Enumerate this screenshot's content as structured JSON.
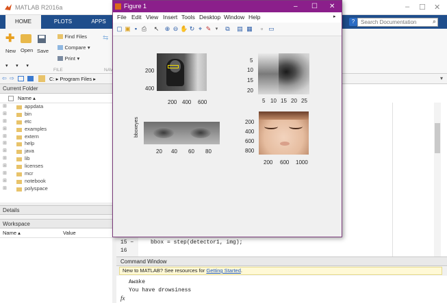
{
  "matlab": {
    "title": "MATLAB R2016a",
    "tabs": [
      "HOME",
      "PLOTS",
      "APPS"
    ],
    "search_placeholder": "Search Documentation",
    "ribbon": {
      "new_label": "New",
      "open_label": "Open",
      "save_label": "Save",
      "find_files_label": "Find Files",
      "compare_label": "Compare",
      "print_label": "Print",
      "file_section": "FILE",
      "nav_section": "NAV"
    },
    "address": "C: ▸ Program Files ▸",
    "current_folder": {
      "title": "Current Folder",
      "name_header": "Name ▴",
      "items": [
        "appdata",
        "bin",
        "etc",
        "examples",
        "extern",
        "help",
        "java",
        "lib",
        "licenses",
        "mcr",
        "notebook",
        "polyspace"
      ]
    },
    "details_title": "Details",
    "workspace": {
      "title": "Workspace",
      "name_header": "Name ▴",
      "value_header": "Value"
    },
    "editor": {
      "lines": [
        {
          "num": "15 −",
          "code": "bbox = step(detector1, img);"
        },
        {
          "num": "16",
          "code": ""
        }
      ]
    },
    "command_window": {
      "title": "Command Window",
      "banner_text": "New to MATLAB? See resources for ",
      "banner_link": "Getting Started",
      "banner_end": ".",
      "output": [
        "Awake",
        "You have drowsiness"
      ],
      "prompt": "fx"
    }
  },
  "figure": {
    "title": "Figure 1",
    "menu": [
      "File",
      "Edit",
      "View",
      "Insert",
      "Tools",
      "Desktop",
      "Window",
      "Help"
    ],
    "plots": [
      {
        "yticks": [
          "200",
          "400"
        ],
        "xticks": [
          "200",
          "400",
          "600"
        ]
      },
      {
        "yticks": [
          "5",
          "10",
          "15",
          "20"
        ],
        "xticks": [
          "5",
          "10",
          "15",
          "20",
          "25"
        ]
      },
      {
        "yticks": [],
        "xticks": [
          "20",
          "40",
          "60",
          "80"
        ],
        "rotated_ytext": "bboxeyes"
      },
      {
        "yticks": [
          "200",
          "400",
          "600",
          "800"
        ],
        "xticks": [
          "200",
          "600",
          "1000"
        ]
      }
    ]
  }
}
